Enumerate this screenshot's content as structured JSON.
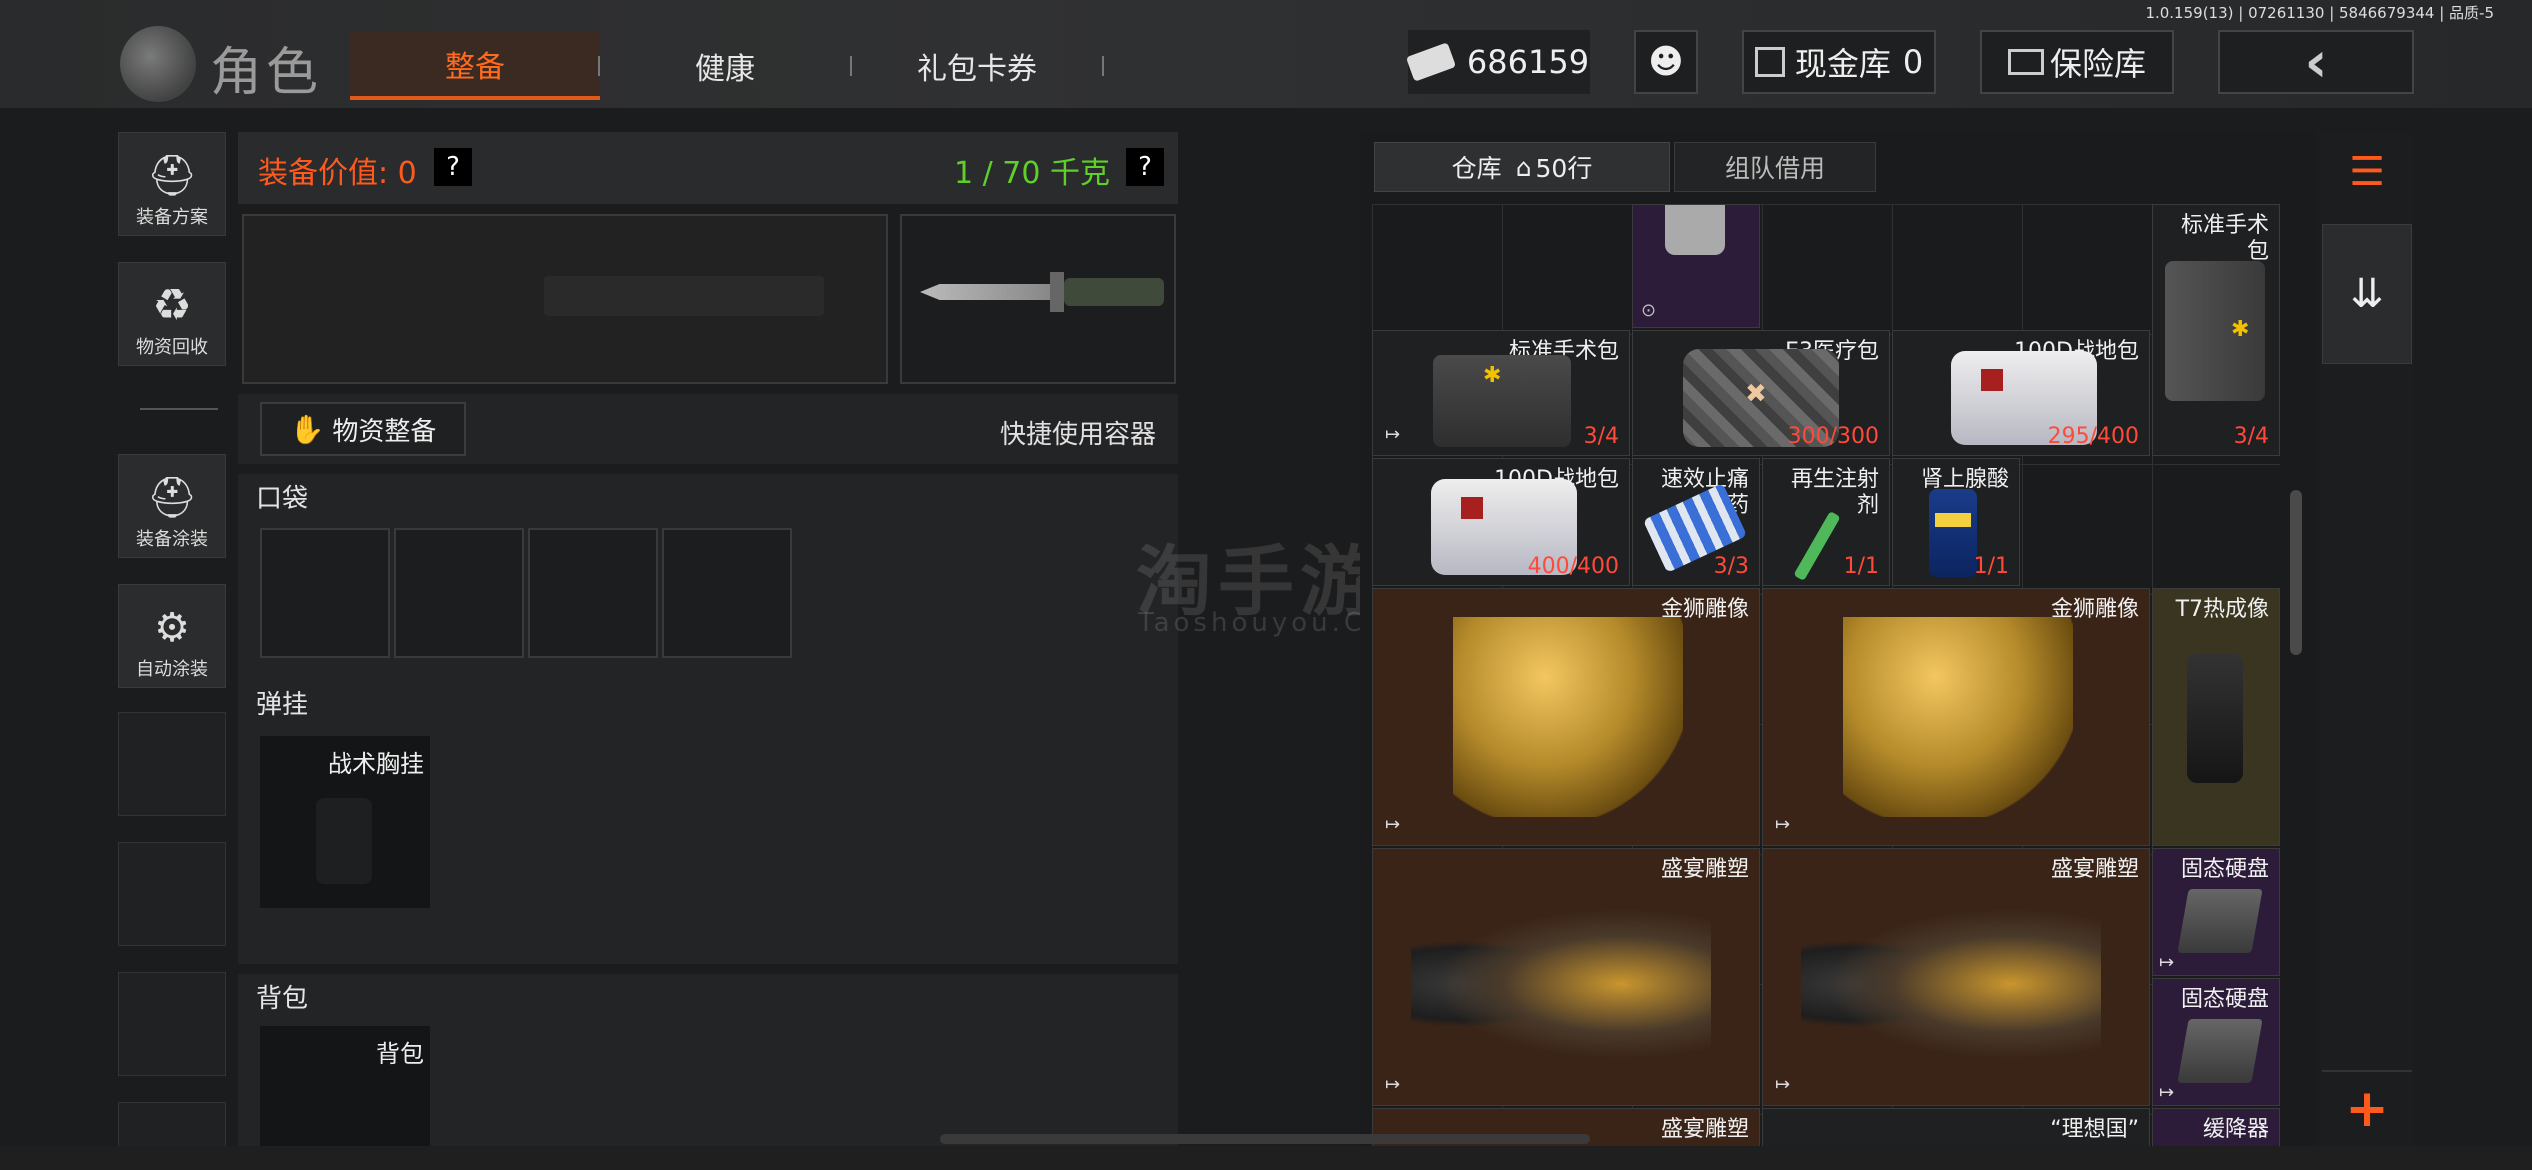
{
  "version_info": "1.0.159(13) | 07261130 | 5846679344 | 品质-5",
  "header": {
    "title": "角色",
    "tabs": [
      "整备",
      "健康",
      "礼包卡券"
    ],
    "active_tab": "整备",
    "currency": "686159",
    "cash_vault_label": "现金库",
    "cash_vault_value": "0",
    "safe_label": "保险库"
  },
  "sidebar": {
    "items": [
      {
        "label": "装备方案",
        "icon": "gear-plan-icon"
      },
      {
        "label": "物资回收",
        "icon": "recycle-icon"
      },
      {
        "label": "装备涂装",
        "icon": "paint-icon"
      },
      {
        "label": "自动涂装",
        "icon": "auto-paint-icon"
      }
    ]
  },
  "loadout": {
    "value_label": "装备价值: 0",
    "help": "?",
    "weight": "1 / 70 千克",
    "supply_button": "物资整备",
    "quick_container": "快捷使用容器",
    "pocket_label": "口袋",
    "rig_label": "弹挂",
    "rig_item": "战术胸挂",
    "backpack_label": "背包",
    "backpack_item": "背包"
  },
  "warehouse": {
    "tab_warehouse": "仓库",
    "rows": "50行",
    "tab_team": "组队借用",
    "items": [
      {
        "name": "标准手术包",
        "count": "3/4"
      },
      {
        "name": "标准手术包",
        "count": "3/4"
      },
      {
        "name": "E3医疗包",
        "count": "300/300"
      },
      {
        "name": "100D战地包",
        "count": "295/400"
      },
      {
        "name": "100D战地包",
        "count": "400/400"
      },
      {
        "name": "速效止痛药",
        "count": "3/3"
      },
      {
        "name": "再生注射剂",
        "count": "1/1"
      },
      {
        "name": "肾上腺酸",
        "count": "1/1"
      },
      {
        "name": "金狮雕像",
        "count": ""
      },
      {
        "name": "金狮雕像",
        "count": ""
      },
      {
        "name": "T7热成像",
        "count": ""
      },
      {
        "name": "盛宴雕塑",
        "count": ""
      },
      {
        "name": "盛宴雕塑",
        "count": ""
      },
      {
        "name": "固态硬盘",
        "count": ""
      },
      {
        "name": "固态硬盘",
        "count": ""
      },
      {
        "name": "盛宴雕塑",
        "count": ""
      },
      {
        "name": "“理想国”",
        "count": ""
      },
      {
        "name": "缓降器",
        "count": ""
      }
    ]
  },
  "watermark": {
    "main": "淘手游",
    "sub": "Taoshouyou.Com"
  },
  "colors": {
    "accent": "#ff6a1e",
    "green": "#5fd02a",
    "gold_bg": "#3a2418",
    "purple_bg": "#2c1c3a",
    "olive_bg": "#3a3520"
  }
}
